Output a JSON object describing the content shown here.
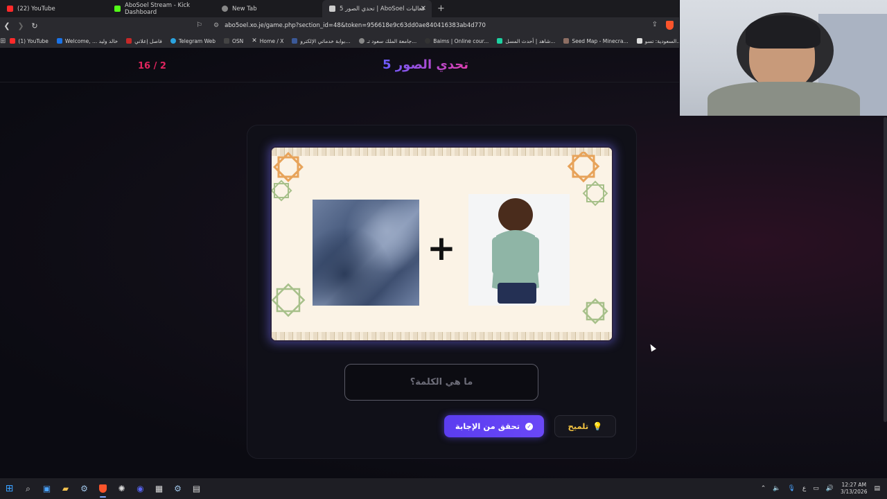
{
  "browser": {
    "tabs": [
      {
        "label": "(22) YouTube",
        "color": "#ff2a2a"
      },
      {
        "label": "AboSoel Stream - Kick Dashboard",
        "color": "#53fc18"
      },
      {
        "label": "New Tab",
        "color": "#888888"
      },
      {
        "label": "تحدي الصور 5 | AboSoel فعاليات",
        "color": "#cccccc",
        "active": true
      }
    ],
    "url": "abo5oel.xo.je/game.php?section_id=48&token=956618e9c63dd0ae840416383ab4d770",
    "bookmarks": [
      {
        "label": "(1) YouTube",
        "color": "#ff2a2a"
      },
      {
        "label": "Welcome, ... خالد وليد",
        "color": "#1a73e8"
      },
      {
        "label": "فاصل إعلاني",
        "color": "#c62828"
      },
      {
        "label": "Telegram Web",
        "color": "#2aa3df"
      },
      {
        "label": "OSN",
        "color": "#000000"
      },
      {
        "label": "Home / X",
        "color": "#000000"
      },
      {
        "label": "بوابة خدماتي الإلكترو...",
        "color": "#3b5998"
      },
      {
        "label": "جامعة الملك سعود تـ...",
        "color": "#888888"
      },
      {
        "label": "Baims | Online cour...",
        "color": "#333333"
      },
      {
        "label": "شاهد | أحدث المسل...",
        "color": "#1dd1a1"
      },
      {
        "label": "Seed Map - Minecra...",
        "color": "#8d6e63"
      },
      {
        "label": "السعودية: تسو...",
        "color": "#333333"
      }
    ]
  },
  "game": {
    "counter": "16 / 2",
    "title": "تحدي الصور 5",
    "answer_placeholder": "ما هي الكلمة؟",
    "check_label": "تحقق من الإجابة",
    "hint_label": "تلميح",
    "puzzle_operator": "+",
    "puzzle_images": [
      "fabric-image",
      "boy-back-image"
    ]
  },
  "colors": {
    "accent": "#5b3df0",
    "counter": "#e0245e",
    "hint": "#f5c542"
  },
  "taskbar": {
    "icons": [
      "windows-start-icon",
      "search-icon",
      "photos-icon",
      "file-explorer-icon",
      "steam-icon",
      "brave-icon",
      "chatgpt-icon",
      "discord-icon",
      "epic-games-icon",
      "steam-icon",
      "calculator-icon"
    ],
    "time": "12:27 AM",
    "date": "3/13/2026",
    "lang": "ع"
  }
}
